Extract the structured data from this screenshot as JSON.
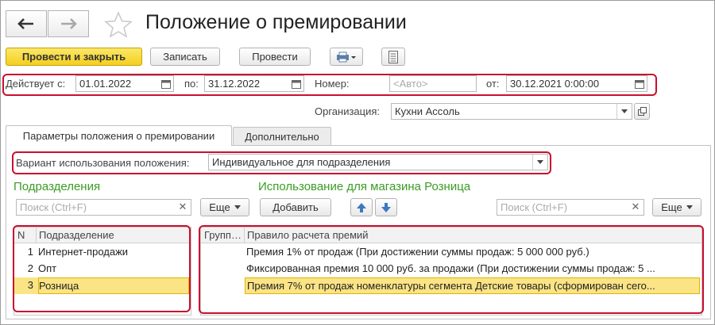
{
  "window": {
    "title": "Положение о премировании"
  },
  "toolbar": {
    "post_close_label": "Провести и закрыть",
    "save_label": "Записать",
    "post_label": "Провести"
  },
  "header": {
    "valid_from_label": "Действует с:",
    "valid_from_value": "01.01.2022",
    "to_label": "по:",
    "to_value": "31.12.2022",
    "number_label": "Номер:",
    "number_placeholder": "<Авто>",
    "date_label": "от:",
    "date_value": "30.12.2021  0:00:00",
    "org_label": "Организация:",
    "org_value": "Кухни Ассоль"
  },
  "tabs": [
    {
      "label": "Параметры положения о премировании"
    },
    {
      "label": "Дополнительно"
    }
  ],
  "variant": {
    "label": "Вариант использования положения:",
    "value": "Индивидуальное для подразделения"
  },
  "departments": {
    "title": "Подразделения",
    "search_placeholder": "Поиск (Ctrl+F)",
    "more_label": "Еще",
    "columns": [
      "N",
      "Подразделение"
    ],
    "rows": [
      {
        "n": "1",
        "name": "Интернет-продажи"
      },
      {
        "n": "2",
        "name": "Опт"
      },
      {
        "n": "3",
        "name": "Розница"
      }
    ]
  },
  "usage": {
    "title": "Использование для магазина Розница",
    "add_label": "Добавить",
    "search_placeholder": "Поиск (Ctrl+F)",
    "more_label": "Еще",
    "columns": [
      "Группа...",
      "Правило расчета премий"
    ],
    "rows": [
      {
        "group": "",
        "rule": "Премия 1% от продаж (При достижении суммы продаж: 5 000 000 руб.)"
      },
      {
        "group": "",
        "rule": "Фиксированная премия 10 000 руб. за продажи (При достижении суммы продаж: 5 ..."
      },
      {
        "group": "",
        "rule": "Премия 7% от продаж номенклатуры сегмента Детские товары (сформирован сего..."
      }
    ]
  },
  "colors": {
    "accent_yellow": "#f4cf1e",
    "section_green": "#3a9d23",
    "highlight_red": "#c8102e",
    "selected_row": "#fbe485"
  }
}
